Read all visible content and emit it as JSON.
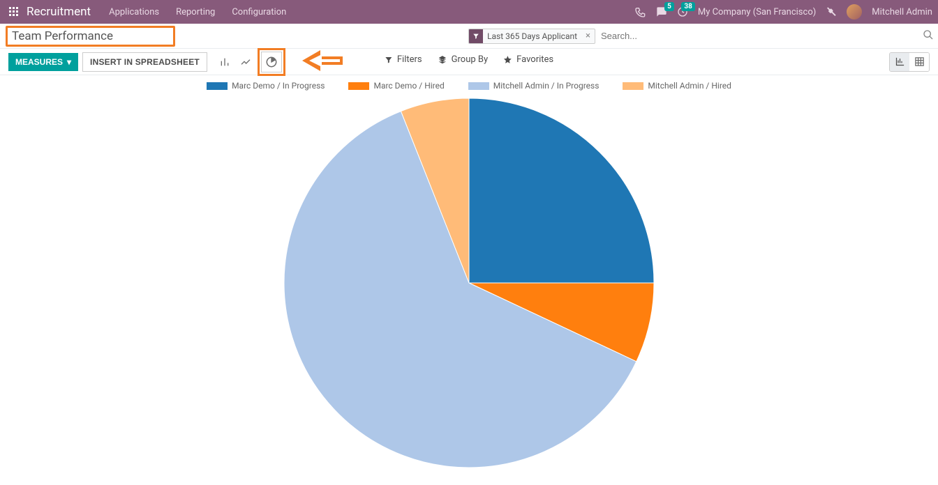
{
  "navbar": {
    "brand": "Recruitment",
    "menu": [
      "Applications",
      "Reporting",
      "Configuration"
    ],
    "chat_badge": "5",
    "clock_badge": "38",
    "company": "My Company (San Francisco)",
    "user": "Mitchell Admin"
  },
  "breadcrumb": {
    "title": "Team Performance"
  },
  "search": {
    "facet_label": "Last 365 Days Applicant",
    "placeholder": "Search..."
  },
  "toolbar": {
    "measures_label": "MEASURES",
    "spreadsheet_label": "INSERT IN SPREADSHEET",
    "filters_label": "Filters",
    "groupby_label": "Group By",
    "favorites_label": "Favorites"
  },
  "chart_data": {
    "type": "pie",
    "title": "",
    "series": [
      {
        "name": "Marc Demo / In Progress",
        "value": 25,
        "color": "#1f77b4"
      },
      {
        "name": "Marc Demo / Hired",
        "value": 7,
        "color": "#ff7f0e"
      },
      {
        "name": "Mitchell Admin / In Progress",
        "value": 62,
        "color": "#aec7e8"
      },
      {
        "name": "Mitchell Admin / Hired",
        "value": 6,
        "color": "#ffbb78"
      }
    ]
  },
  "colors": {
    "accent": "#875a7b",
    "primary_btn": "#00a09d",
    "highlight": "#f27d24"
  }
}
